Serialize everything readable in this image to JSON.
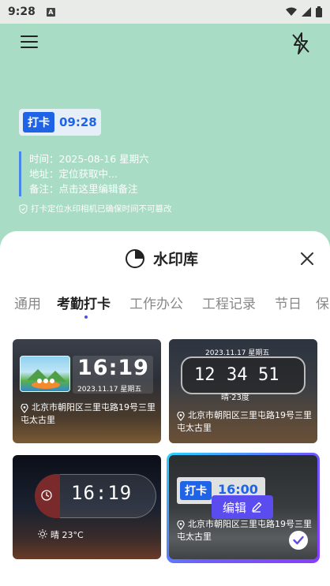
{
  "status": {
    "time": "9:28",
    "sim": "A"
  },
  "preview": {
    "tag": "打卡",
    "time": "09:28",
    "lines": [
      "时间：2025-08-16 星期六",
      "地址：定位获取中...",
      "备注：点击这里编辑备注"
    ],
    "hint": "打卡定位水印相机已确保时间不可篡改"
  },
  "sheet": {
    "title": "水印库",
    "tabs": [
      "通用",
      "考勤打卡",
      "工作办公",
      "工程记录",
      "节日",
      "保"
    ],
    "active_tab": 1
  },
  "cards": {
    "c1": {
      "time": "16:19",
      "date": "2023.11.17 星期五",
      "address": "北京市朝阳区三里屯路19号三里屯太古里"
    },
    "c2": {
      "date": "2023.11.17 星期五",
      "h": "12",
      "m": "34",
      "s": "51",
      "weather": "晴·23度",
      "address": "北京市朝阳区三里屯路19号三里屯太古里"
    },
    "c3": {
      "time": "16:19",
      "weather": "晴 23°C"
    },
    "c4": {
      "tag": "打卡",
      "time": "16:00",
      "address": "北京市朝阳区三里屯路19号三里屯太古里",
      "edit": "编辑"
    }
  },
  "colors": {
    "accent": "#1f63e6",
    "bg": "#a8dcc4",
    "edit": "#5b4cf0"
  }
}
